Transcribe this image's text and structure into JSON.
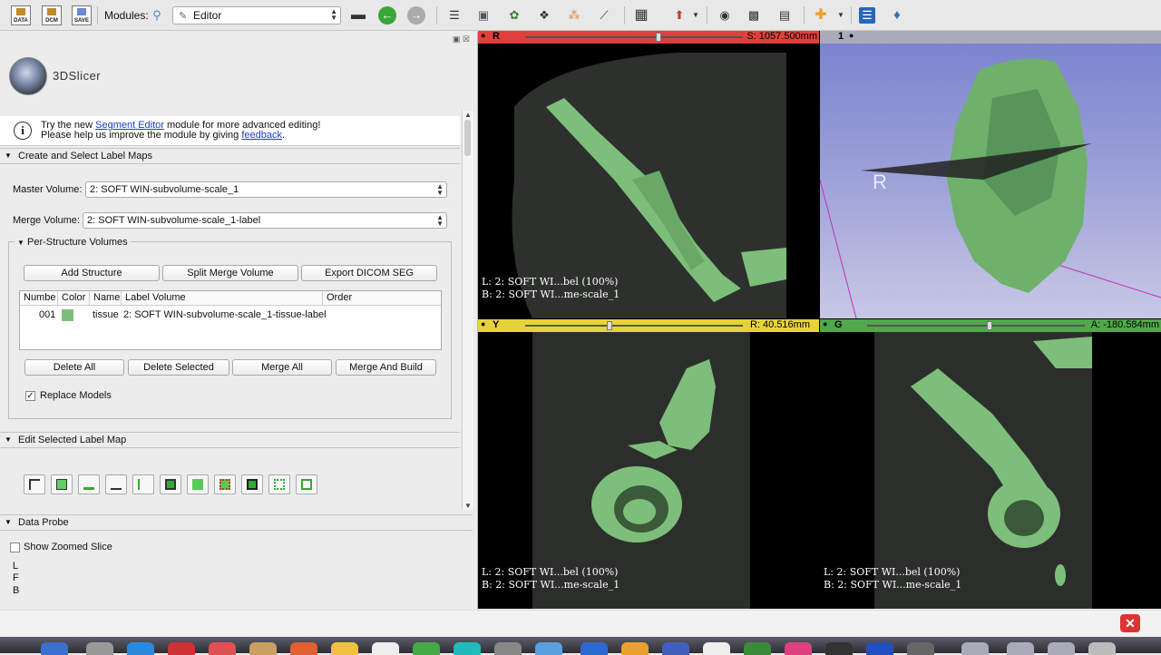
{
  "toolbar": {
    "data_label": "DATA",
    "dcm_label": "DCM",
    "save_label": "SAVE",
    "modules_label": "Modules:",
    "module_selected": "Editor"
  },
  "panel": {
    "app_name": "3DSlicer",
    "info_line1_prefix": "Try the new ",
    "info_link1": "Segment Editor",
    "info_line1_suffix": " module for more advanced editing!",
    "info_line2_prefix": "Please help us improve the module by giving ",
    "info_link2": "feedback",
    "info_line2_suffix": ".",
    "section_create": "Create and Select Label Maps",
    "master_label": "Master Volume:",
    "master_value": "2: SOFT WIN-subvolume-scale_1",
    "merge_label": "Merge Volume:",
    "merge_value": "2: SOFT WIN-subvolume-scale_1-label",
    "per_structure": "Per-Structure Volumes",
    "btn_add": "Add Structure",
    "btn_split": "Split Merge Volume",
    "btn_export": "Export DICOM SEG",
    "table_headers": [
      "Numbe",
      "Color",
      "Name",
      "Label Volume",
      "Order"
    ],
    "row": {
      "number": "001",
      "name": "tissue",
      "label_volume": "2: SOFT WIN-subvolume-scale_1-tissue-label"
    },
    "btn_delete_all": "Delete All",
    "btn_delete_selected": "Delete Selected",
    "btn_merge_all": "Merge All",
    "btn_merge_build": "Merge And Build",
    "replace_models": "Replace Models",
    "section_edit": "Edit Selected Label Map",
    "section_probe": "Data Probe",
    "show_zoomed": "Show Zoomed Slice",
    "probe_l": "L",
    "probe_f": "F",
    "probe_b": "B"
  },
  "views": {
    "red": {
      "tag": "R",
      "value": "S: 1057.500mm"
    },
    "threed": {
      "tag": "1",
      "orientation": "R"
    },
    "yellow": {
      "tag": "Y",
      "value": "R: 40.516mm"
    },
    "green": {
      "tag": "G",
      "value": "A: -180.584mm"
    },
    "overlay_l": "L: 2: SOFT WI...bel (100%)",
    "overlay_b": "B: 2: SOFT WI...me-scale_1"
  },
  "colors": {
    "red_bar": "#e0403c",
    "yellow_bar": "#e8d23a",
    "green_bar": "#4fa84a",
    "label_green": "#7dbf7a",
    "threed_bg": "#8f95d4"
  }
}
